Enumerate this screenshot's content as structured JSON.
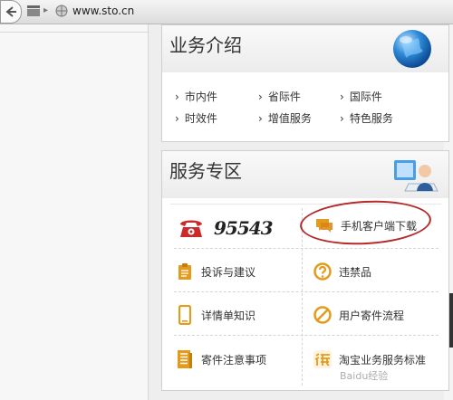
{
  "browser": {
    "url": "www.sto.cn"
  },
  "business": {
    "title": "业务介绍",
    "items": [
      "市内件",
      "省际件",
      "国际件",
      "时效件",
      "增值服务",
      "特色服务"
    ]
  },
  "service": {
    "title": "服务专区",
    "hotline": "95543",
    "items": {
      "app_download": "手机客户端下载",
      "complaint": "投诉与建议",
      "prohibited": "违禁品",
      "waybill": "详情单知识",
      "process": "用户寄件流程",
      "notice": "寄件注意事项",
      "taobao": "淘宝业务服务标准"
    }
  },
  "watermark": "Baidu经验",
  "colors": {
    "accent_red": "#b52a2a",
    "icon_orange": "#e49b1b",
    "icon_red": "#cc2a2a"
  }
}
